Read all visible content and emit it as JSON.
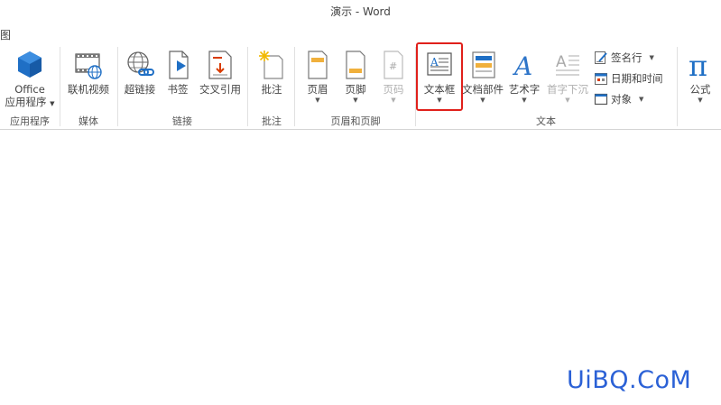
{
  "window": {
    "title": "演示 - Word"
  },
  "menu_fragment": "图",
  "ribbon": {
    "groups": {
      "apps": "应用程序",
      "media": "媒体",
      "links": "链接",
      "comments": "批注",
      "header_footer": "页眉和页脚",
      "text": "文本"
    },
    "buttons": {
      "office_line1": "Office",
      "office_line2": "应用程序",
      "online_video": "联机视频",
      "hyperlink": "超链接",
      "bookmark": "书签",
      "cross_reference": "交叉引用",
      "comment": "批注",
      "header": "页眉",
      "footer": "页脚",
      "page_number": "页码",
      "text_box": "文本框",
      "quick_parts": "文档部件",
      "wordart": "艺术字",
      "drop_cap": "首字下沉",
      "signature_line": "签名行",
      "date_time": "日期和时间",
      "object": "对象",
      "equation": "公式"
    },
    "caret": "▼",
    "accent_color": "#e0201b",
    "office_icon_color": "#1f6fc5"
  },
  "watermark": "UiBQ.CoM"
}
